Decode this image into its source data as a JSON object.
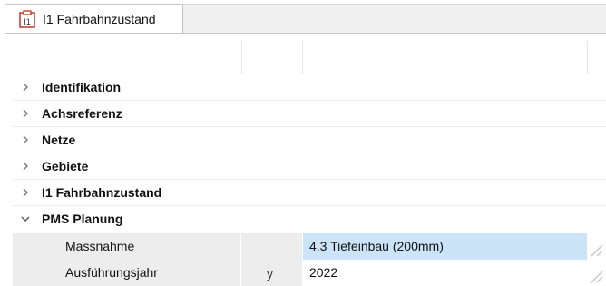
{
  "tab": {
    "icon": "document-form-icon",
    "label": "I1 Fahrbahnzustand",
    "icon_text": "I1"
  },
  "groups": [
    {
      "label": "Identifikation",
      "expanded": false
    },
    {
      "label": "Achsreferenz",
      "expanded": false
    },
    {
      "label": "Netze",
      "expanded": false
    },
    {
      "label": "Gebiete",
      "expanded": false
    },
    {
      "label": "I1 Fahrbahnzustand",
      "expanded": false
    },
    {
      "label": "PMS Planung",
      "expanded": true
    }
  ],
  "properties": [
    {
      "name": "Massnahme",
      "flag": "",
      "value": "4.3 Tiefeinbau (200mm)",
      "selected": true
    },
    {
      "name": "Ausführungsjahr",
      "flag": "y",
      "value": "2022",
      "selected": false
    }
  ],
  "colors": {
    "selection": "#cce4f7",
    "name_cell": "#ededed",
    "icon_accent": "#c0392b"
  }
}
